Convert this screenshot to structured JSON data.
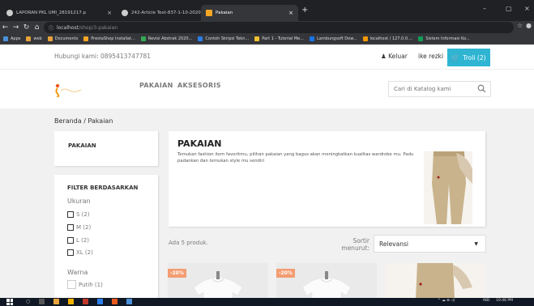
{
  "browser": {
    "tabs": [
      {
        "title": "LAPORAN PKL UMI_28191217.p",
        "close": "×"
      },
      {
        "title": "242-Article Text-837-1-10-2020",
        "close": "×"
      },
      {
        "title": "Pakaian",
        "close": "×"
      }
    ],
    "new_tab": "+",
    "url_host": "localhost",
    "url_path": "/shop/3-pakaian",
    "bookmarks": [
      "Apps",
      "web",
      "Documents",
      "PrestaShop Installat...",
      "Revisi Abstrak 2020...",
      "Contoh Skripsi Tekn...",
      "Part 1 - Tutorial Me...",
      "Lambungsoft Dow...",
      "localhost / 127.0.0....",
      "Sistem Informasi Ko..."
    ]
  },
  "header": {
    "contact": "Hubungi kami: 0895413747781",
    "logout": "Keluar",
    "user": "ike rezki",
    "cart": "Troli (2)",
    "nav": [
      "PAKAIAN",
      "AKSESORIS"
    ],
    "search_placeholder": "Cari di Katalog kami"
  },
  "breadcrumb": "Beranda  /  Pakaian",
  "sidebar": {
    "category": "PAKAIAN",
    "filter_title": "FILTER BERDASARKAN",
    "size_title": "Ukuran",
    "sizes": [
      "S (2)",
      "M (2)",
      "L (2)",
      "XL (2)"
    ],
    "color_title": "Warna",
    "colors": [
      "Putih (1)"
    ]
  },
  "category": {
    "title": "PAKAIAN",
    "description": "Temukan fashion item favoritmu, pilihan pakaian yang bagus akan meningkatkan kualitas wardrobe mu. Padu padankan dan temukan style mu sendiri"
  },
  "listing": {
    "count": "Ada 5 produk.",
    "sort_label_1": "Sortir",
    "sort_label_2": "menurut:",
    "sort_value": "Relevansi",
    "products": [
      {
        "badge": "-20%"
      },
      {
        "badge": "-20%"
      },
      {
        "badge": ""
      }
    ]
  },
  "taskbar": {
    "tray_lang": "IND",
    "tray_time": "10:46 PM"
  },
  "colors": {
    "accent": "#2fb5d2",
    "discount": "#f39d72"
  }
}
